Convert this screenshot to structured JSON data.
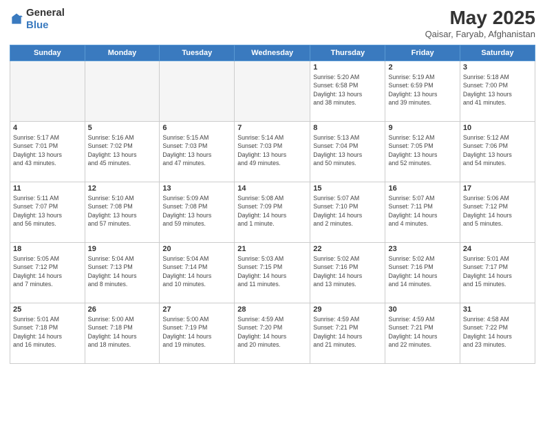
{
  "header": {
    "logo_general": "General",
    "logo_blue": "Blue",
    "month_year": "May 2025",
    "location": "Qaisar, Faryab, Afghanistan"
  },
  "weekdays": [
    "Sunday",
    "Monday",
    "Tuesday",
    "Wednesday",
    "Thursday",
    "Friday",
    "Saturday"
  ],
  "weeks": [
    [
      {
        "day": "",
        "info": ""
      },
      {
        "day": "",
        "info": ""
      },
      {
        "day": "",
        "info": ""
      },
      {
        "day": "",
        "info": ""
      },
      {
        "day": "1",
        "info": "Sunrise: 5:20 AM\nSunset: 6:58 PM\nDaylight: 13 hours\nand 38 minutes."
      },
      {
        "day": "2",
        "info": "Sunrise: 5:19 AM\nSunset: 6:59 PM\nDaylight: 13 hours\nand 39 minutes."
      },
      {
        "day": "3",
        "info": "Sunrise: 5:18 AM\nSunset: 7:00 PM\nDaylight: 13 hours\nand 41 minutes."
      }
    ],
    [
      {
        "day": "4",
        "info": "Sunrise: 5:17 AM\nSunset: 7:01 PM\nDaylight: 13 hours\nand 43 minutes."
      },
      {
        "day": "5",
        "info": "Sunrise: 5:16 AM\nSunset: 7:02 PM\nDaylight: 13 hours\nand 45 minutes."
      },
      {
        "day": "6",
        "info": "Sunrise: 5:15 AM\nSunset: 7:03 PM\nDaylight: 13 hours\nand 47 minutes."
      },
      {
        "day": "7",
        "info": "Sunrise: 5:14 AM\nSunset: 7:03 PM\nDaylight: 13 hours\nand 49 minutes."
      },
      {
        "day": "8",
        "info": "Sunrise: 5:13 AM\nSunset: 7:04 PM\nDaylight: 13 hours\nand 50 minutes."
      },
      {
        "day": "9",
        "info": "Sunrise: 5:12 AM\nSunset: 7:05 PM\nDaylight: 13 hours\nand 52 minutes."
      },
      {
        "day": "10",
        "info": "Sunrise: 5:12 AM\nSunset: 7:06 PM\nDaylight: 13 hours\nand 54 minutes."
      }
    ],
    [
      {
        "day": "11",
        "info": "Sunrise: 5:11 AM\nSunset: 7:07 PM\nDaylight: 13 hours\nand 56 minutes."
      },
      {
        "day": "12",
        "info": "Sunrise: 5:10 AM\nSunset: 7:08 PM\nDaylight: 13 hours\nand 57 minutes."
      },
      {
        "day": "13",
        "info": "Sunrise: 5:09 AM\nSunset: 7:08 PM\nDaylight: 13 hours\nand 59 minutes."
      },
      {
        "day": "14",
        "info": "Sunrise: 5:08 AM\nSunset: 7:09 PM\nDaylight: 14 hours\nand 1 minute."
      },
      {
        "day": "15",
        "info": "Sunrise: 5:07 AM\nSunset: 7:10 PM\nDaylight: 14 hours\nand 2 minutes."
      },
      {
        "day": "16",
        "info": "Sunrise: 5:07 AM\nSunset: 7:11 PM\nDaylight: 14 hours\nand 4 minutes."
      },
      {
        "day": "17",
        "info": "Sunrise: 5:06 AM\nSunset: 7:12 PM\nDaylight: 14 hours\nand 5 minutes."
      }
    ],
    [
      {
        "day": "18",
        "info": "Sunrise: 5:05 AM\nSunset: 7:12 PM\nDaylight: 14 hours\nand 7 minutes."
      },
      {
        "day": "19",
        "info": "Sunrise: 5:04 AM\nSunset: 7:13 PM\nDaylight: 14 hours\nand 8 minutes."
      },
      {
        "day": "20",
        "info": "Sunrise: 5:04 AM\nSunset: 7:14 PM\nDaylight: 14 hours\nand 10 minutes."
      },
      {
        "day": "21",
        "info": "Sunrise: 5:03 AM\nSunset: 7:15 PM\nDaylight: 14 hours\nand 11 minutes."
      },
      {
        "day": "22",
        "info": "Sunrise: 5:02 AM\nSunset: 7:16 PM\nDaylight: 14 hours\nand 13 minutes."
      },
      {
        "day": "23",
        "info": "Sunrise: 5:02 AM\nSunset: 7:16 PM\nDaylight: 14 hours\nand 14 minutes."
      },
      {
        "day": "24",
        "info": "Sunrise: 5:01 AM\nSunset: 7:17 PM\nDaylight: 14 hours\nand 15 minutes."
      }
    ],
    [
      {
        "day": "25",
        "info": "Sunrise: 5:01 AM\nSunset: 7:18 PM\nDaylight: 14 hours\nand 16 minutes."
      },
      {
        "day": "26",
        "info": "Sunrise: 5:00 AM\nSunset: 7:18 PM\nDaylight: 14 hours\nand 18 minutes."
      },
      {
        "day": "27",
        "info": "Sunrise: 5:00 AM\nSunset: 7:19 PM\nDaylight: 14 hours\nand 19 minutes."
      },
      {
        "day": "28",
        "info": "Sunrise: 4:59 AM\nSunset: 7:20 PM\nDaylight: 14 hours\nand 20 minutes."
      },
      {
        "day": "29",
        "info": "Sunrise: 4:59 AM\nSunset: 7:21 PM\nDaylight: 14 hours\nand 21 minutes."
      },
      {
        "day": "30",
        "info": "Sunrise: 4:59 AM\nSunset: 7:21 PM\nDaylight: 14 hours\nand 22 minutes."
      },
      {
        "day": "31",
        "info": "Sunrise: 4:58 AM\nSunset: 7:22 PM\nDaylight: 14 hours\nand 23 minutes."
      }
    ]
  ]
}
